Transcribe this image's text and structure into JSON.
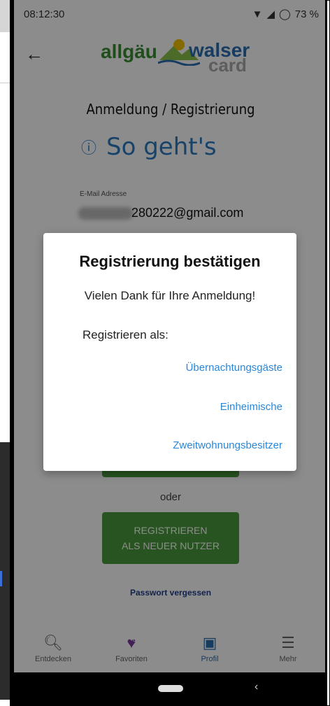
{
  "status_bar": {
    "time": "08:12:30",
    "battery": "73 %"
  },
  "app_bar": {
    "back_icon": "back-arrow-icon",
    "logo_part1": "allgäu",
    "logo_part2": "walser",
    "logo_part3": "card"
  },
  "page": {
    "title": "Anmeldung / Registrierung",
    "howto": "So geht's",
    "email_label": "E-Mail Adresse",
    "email_value": "280222@gmail.com",
    "or_text": "oder",
    "register_line1": "REGISTRIEREN",
    "register_line2": "ALS NEUER NUTZER",
    "forgot_password": "Passwort vergessen"
  },
  "dialog": {
    "title": "Registrierung bestätigen",
    "message": "Vielen Dank für Ihre Anmeldung!",
    "subtitle": "Registrieren als:",
    "options": [
      "Übernachtungsgäste",
      "Einheimische",
      "Zweitwohnungsbesitzer"
    ]
  },
  "bottom_nav": {
    "items": [
      {
        "label": "Entdecken",
        "icon": "search-icon"
      },
      {
        "label": "Favoriten",
        "icon": "heart-icon",
        "badge": "0"
      },
      {
        "label": "Profil",
        "icon": "profile-icon"
      },
      {
        "label": "Mehr",
        "icon": "menu-icon"
      }
    ]
  },
  "colors": {
    "accent": "#2a87d8",
    "green": "#4a9a3c",
    "title_blue": "#2a7ac4"
  }
}
